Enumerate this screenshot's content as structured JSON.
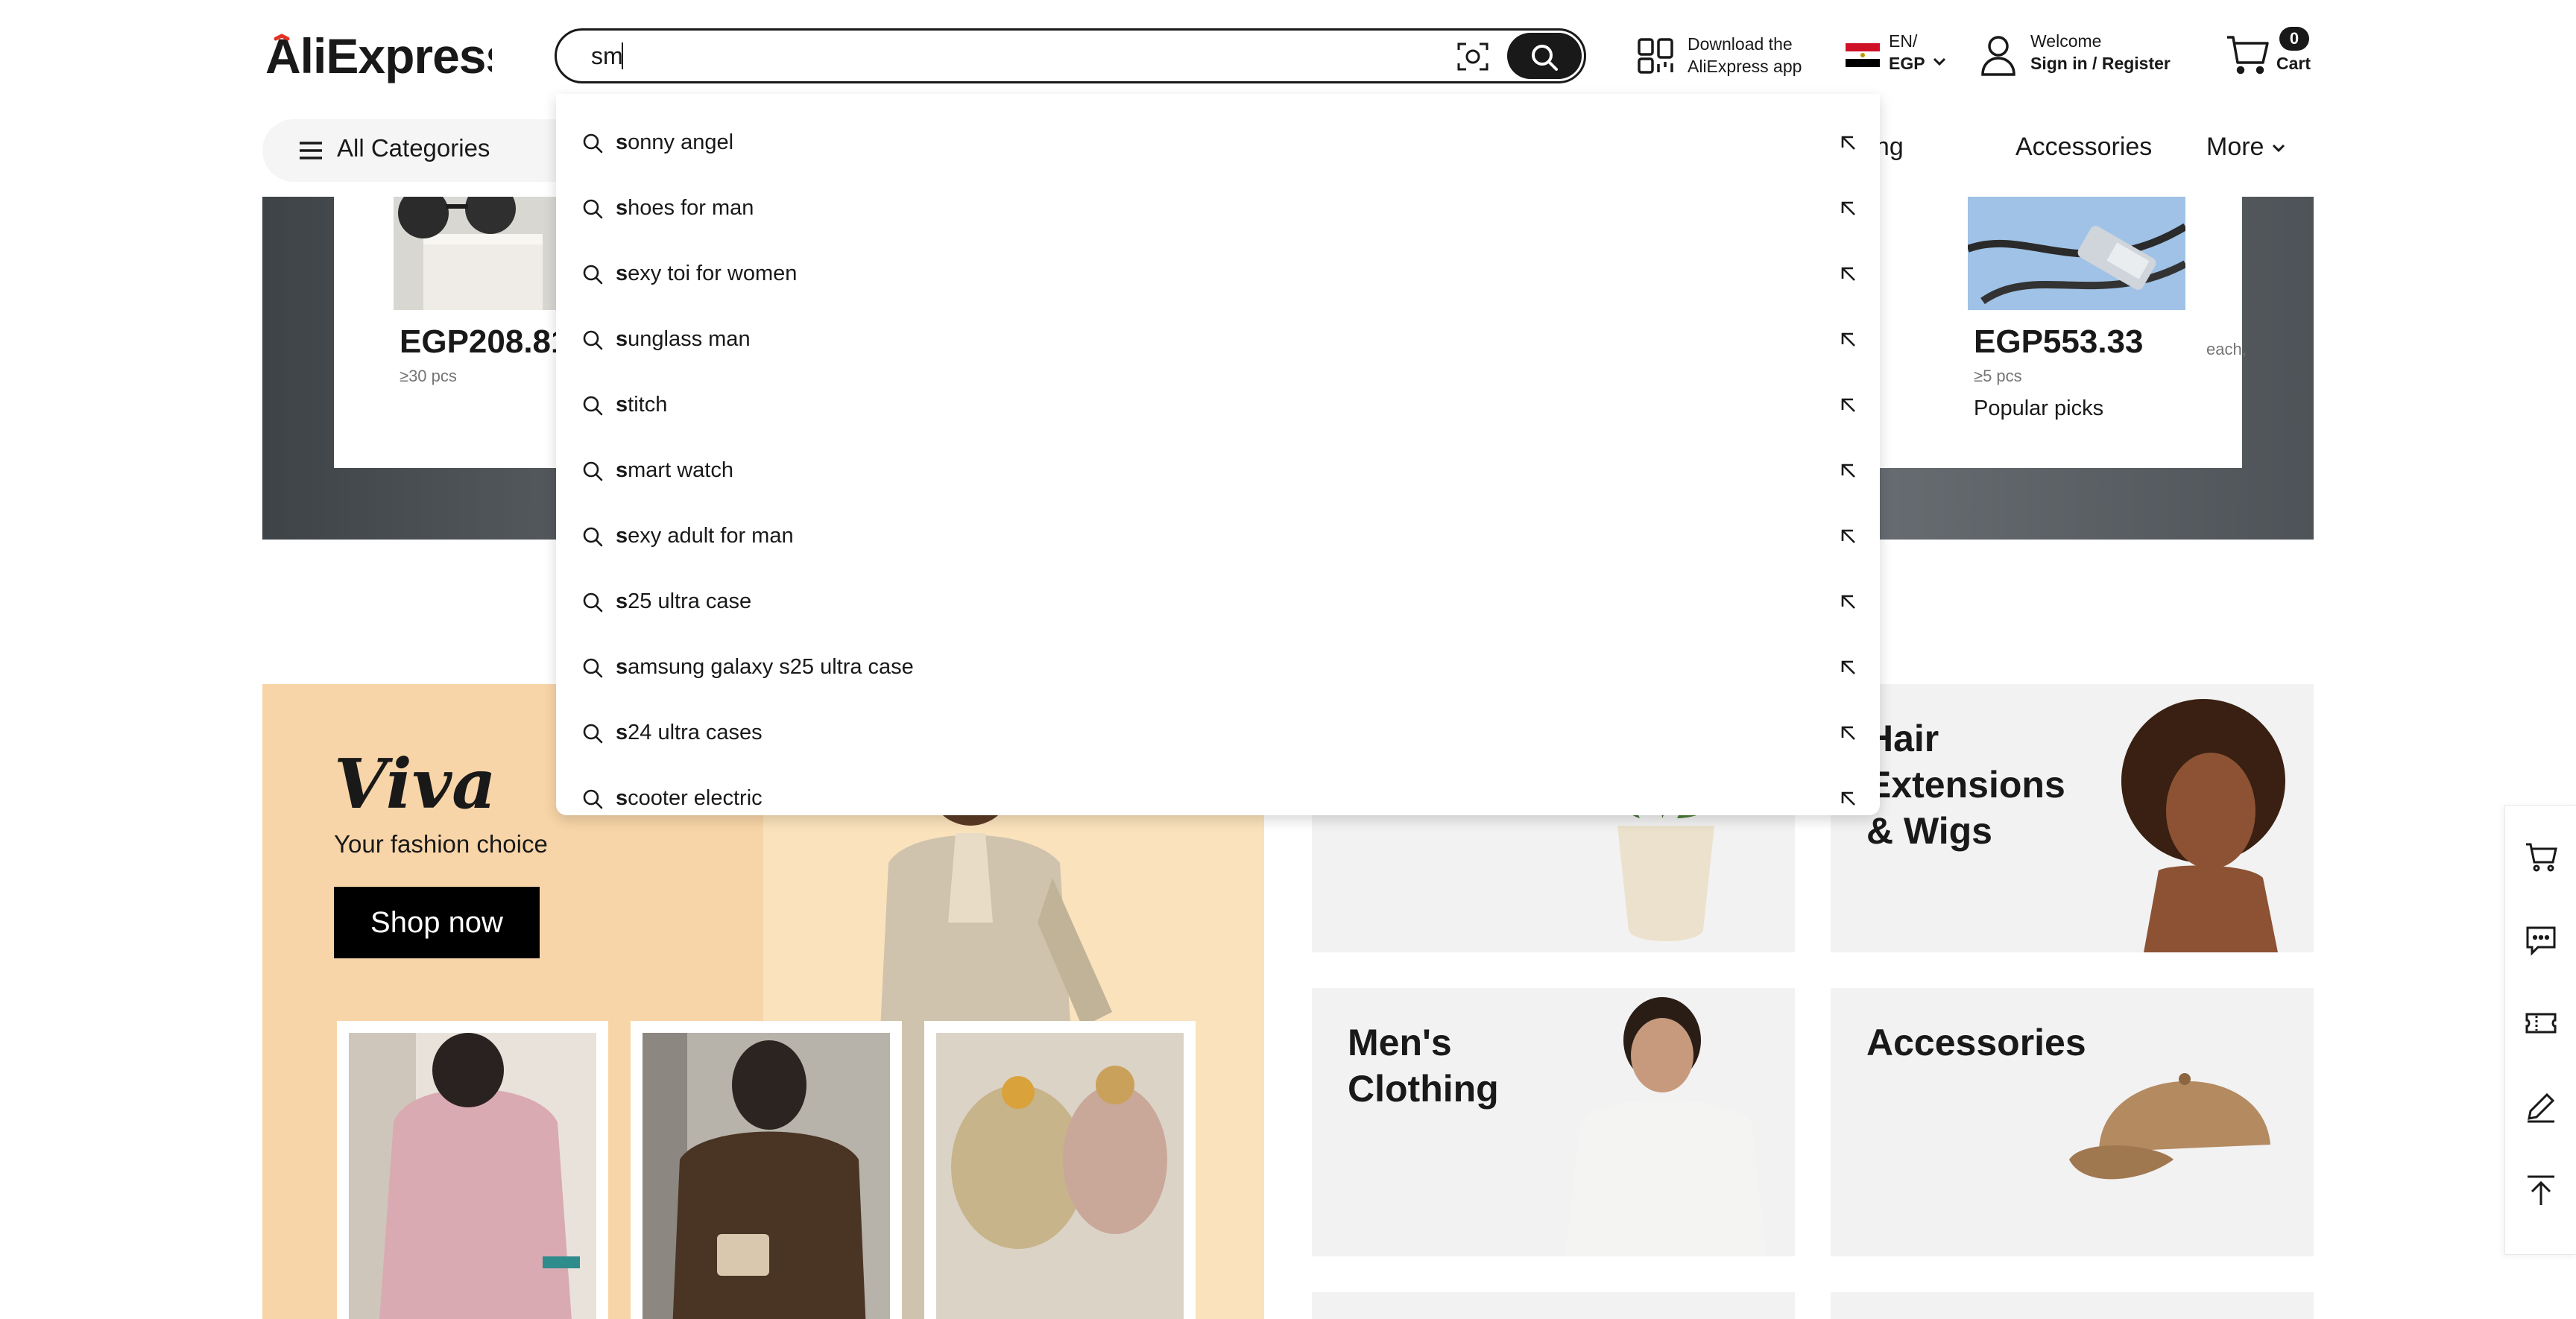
{
  "brand": {
    "logo_text": "AliExpress",
    "accent_color": "#e43225"
  },
  "search": {
    "value": "sm",
    "placeholder": ""
  },
  "header": {
    "app_line1": "Download the",
    "app_line2": "AliExpress app",
    "lang_line1": "EN/",
    "lang_line2": "EGP",
    "welcome": "Welcome",
    "sign_in": "Sign in / Register",
    "cart_count": "0",
    "cart_label": "Cart"
  },
  "nav": {
    "all_categories": "All Categories",
    "partial_link": "thing",
    "accessories": "Accessories",
    "more": "More"
  },
  "suggestions": [
    {
      "first": "s",
      "rest": "onny angel"
    },
    {
      "first": "s",
      "rest": "hoes for man"
    },
    {
      "first": "s",
      "rest": "exy toi for women"
    },
    {
      "first": "s",
      "rest": "unglass man"
    },
    {
      "first": "s",
      "rest": "titch"
    },
    {
      "first": "s",
      "rest": "mart watch"
    },
    {
      "first": "s",
      "rest": "exy adult for man"
    },
    {
      "first": "s",
      "rest": "25 ultra case"
    },
    {
      "first": "s",
      "rest": "amsung galaxy s25 ultra case"
    },
    {
      "first": "s",
      "rest": "24 ultra cases"
    },
    {
      "first": "s",
      "rest": "cooter electric"
    }
  ],
  "banner": {
    "left_price": "EGP208.81",
    "left_note": "≥30 pcs",
    "right_price": "EGP553.33",
    "right_each": "each,",
    "right_note": "≥5 pcs",
    "right_tag": "Popular picks"
  },
  "viva": {
    "title": "Viva",
    "subtitle": "Your fashion choice",
    "shop_now": "Shop now"
  },
  "categories": {
    "hair": "Hair\nExtensions\n& Wigs",
    "mens": "Men's\nClothing",
    "accessories": "Accessories"
  },
  "sidebar_icons": [
    "cart-icon",
    "chat-icon",
    "coupon-icon",
    "edit-icon",
    "back-to-top-icon"
  ]
}
